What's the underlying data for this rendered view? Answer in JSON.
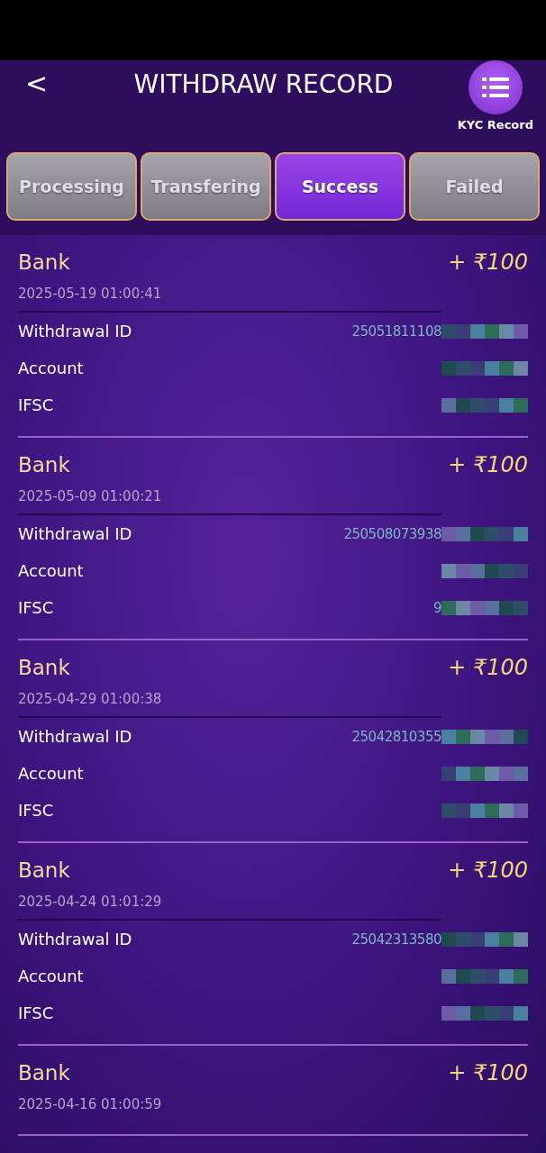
{
  "header": {
    "title": "WITHDRAW RECORD",
    "back": "<",
    "kyc_label": "KYC Record"
  },
  "tabs": [
    {
      "label": "Processing",
      "selected": false
    },
    {
      "label": "Transfering",
      "selected": false
    },
    {
      "label": "Success",
      "selected": true
    },
    {
      "label": "Failed",
      "selected": false
    }
  ],
  "records": [
    {
      "method": "Bank",
      "amount": "+ ₹100",
      "date": "2025-05-19 01:00:41",
      "fields": [
        {
          "label": "Withdrawal ID",
          "value": "25051811108",
          "masked": true
        },
        {
          "label": "Account",
          "masked": true
        },
        {
          "label": "IFSC",
          "masked": true
        }
      ]
    },
    {
      "method": "Bank",
      "amount": "+ ₹100",
      "date": "2025-05-09 01:00:21",
      "fields": [
        {
          "label": "Withdrawal ID",
          "value": "250508073938",
          "masked": true
        },
        {
          "label": "Account",
          "masked": true
        },
        {
          "label": "IFSC",
          "value": "9",
          "masked": true
        }
      ]
    },
    {
      "method": "Bank",
      "amount": "+ ₹100",
      "date": "2025-04-29 01:00:38",
      "fields": [
        {
          "label": "Withdrawal ID",
          "value": "25042810355",
          "masked": true
        },
        {
          "label": "Account",
          "masked": true
        },
        {
          "label": "IFSC",
          "masked": true
        }
      ]
    },
    {
      "method": "Bank",
      "amount": "+ ₹100",
      "date": "2025-04-24 01:01:29",
      "fields": [
        {
          "label": "Withdrawal ID",
          "value": "25042313580",
          "masked": true
        },
        {
          "label": "Account",
          "masked": true
        },
        {
          "label": "IFSC",
          "masked": true
        }
      ]
    },
    {
      "method": "Bank",
      "amount": "+ ₹100",
      "date": "2025-04-16 01:00:59"
    }
  ]
}
